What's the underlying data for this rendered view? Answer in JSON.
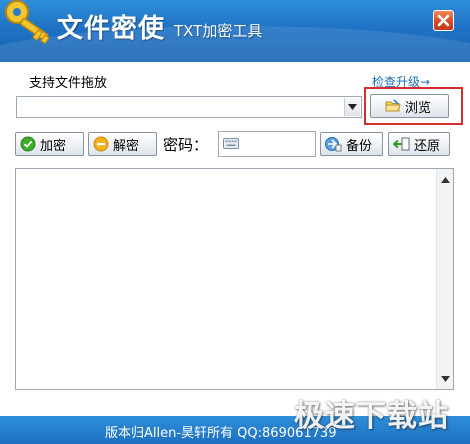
{
  "window": {
    "title": "文件密使",
    "subtitle": "TXT加密工具"
  },
  "file": {
    "support_label": "支持文件拖放",
    "update_link": "检查升级→",
    "path_value": "",
    "browse_label": "浏览"
  },
  "toolbar": {
    "encrypt_label": "加密",
    "decrypt_label": "解密",
    "password_label": "密码：",
    "password_value": "",
    "backup_label": "备份",
    "restore_label": "还原"
  },
  "editor": {
    "content": ""
  },
  "footer": {
    "copyright": "版本归Allen-昊轩所有  QQ:869061739",
    "watermark": "极速下载站"
  },
  "colors": {
    "title_bar": "#1f72c4",
    "highlight": "#d32f2f",
    "link": "#1e6fb0"
  },
  "icons": {
    "app": "key-icon",
    "close": "close-icon",
    "browse": "folder-icon",
    "encrypt": "check-circle-icon",
    "decrypt": "minus-circle-icon",
    "password": "keyboard-icon",
    "backup": "backup-icon",
    "restore": "restore-icon"
  }
}
